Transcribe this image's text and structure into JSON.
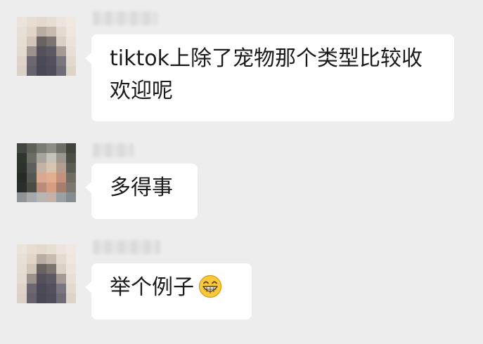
{
  "messages": [
    {
      "sender": "other",
      "text": "tiktok上除了宠物那个类型比较收欢迎呢"
    },
    {
      "sender": "other",
      "text": "多得事"
    },
    {
      "sender": "other",
      "text": "举个例子",
      "emoji": "grinning-face-icon"
    }
  ],
  "colors": {
    "background": "#ededed",
    "bubble": "#ffffff",
    "text": "#1a1a1a"
  }
}
